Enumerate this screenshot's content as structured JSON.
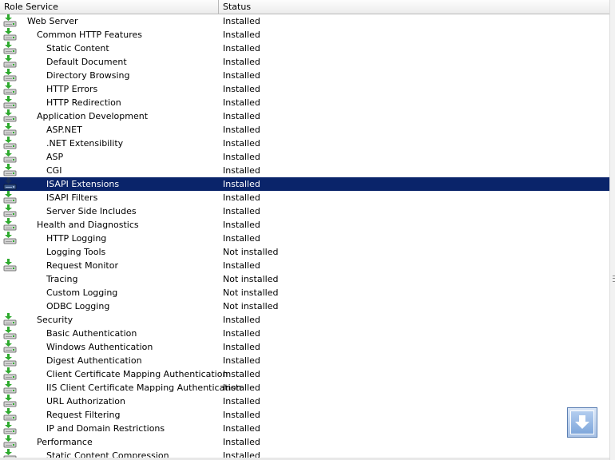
{
  "header": {
    "role_service": "Role Service",
    "status": "Status"
  },
  "rows": [
    {
      "name": "Web Server",
      "status": "Installed",
      "level": 0,
      "icon": "installed-icon"
    },
    {
      "name": "Common HTTP Features",
      "status": "Installed",
      "level": 1,
      "icon": "installed-icon"
    },
    {
      "name": "Static Content",
      "status": "Installed",
      "level": 2,
      "icon": "installed-icon"
    },
    {
      "name": "Default Document",
      "status": "Installed",
      "level": 2,
      "icon": "installed-icon"
    },
    {
      "name": "Directory Browsing",
      "status": "Installed",
      "level": 2,
      "icon": "installed-icon"
    },
    {
      "name": "HTTP Errors",
      "status": "Installed",
      "level": 2,
      "icon": "installed-icon"
    },
    {
      "name": "HTTP Redirection",
      "status": "Installed",
      "level": 2,
      "icon": "installed-icon"
    },
    {
      "name": "Application Development",
      "status": "Installed",
      "level": 1,
      "icon": "installed-icon"
    },
    {
      "name": "ASP.NET",
      "status": "Installed",
      "level": 2,
      "icon": "installed-icon"
    },
    {
      "name": ".NET Extensibility",
      "status": "Installed",
      "level": 2,
      "icon": "installed-icon"
    },
    {
      "name": "ASP",
      "status": "Installed",
      "level": 2,
      "icon": "installed-icon"
    },
    {
      "name": "CGI",
      "status": "Installed",
      "level": 2,
      "icon": "installed-icon"
    },
    {
      "name": "ISAPI Extensions",
      "status": "Installed",
      "level": 2,
      "icon": "installed-icon",
      "selected": true
    },
    {
      "name": "ISAPI Filters",
      "status": "Installed",
      "level": 2,
      "icon": "installed-icon"
    },
    {
      "name": "Server Side Includes",
      "status": "Installed",
      "level": 2,
      "icon": "installed-icon"
    },
    {
      "name": "Health and Diagnostics",
      "status": "Installed",
      "level": 1,
      "icon": "installed-icon"
    },
    {
      "name": "HTTP Logging",
      "status": "Installed",
      "level": 2,
      "icon": "installed-icon"
    },
    {
      "name": "Logging Tools",
      "status": "Not installed",
      "level": 2,
      "icon": ""
    },
    {
      "name": "Request Monitor",
      "status": "Installed",
      "level": 2,
      "icon": "installed-icon"
    },
    {
      "name": "Tracing",
      "status": "Not installed",
      "level": 2,
      "icon": ""
    },
    {
      "name": "Custom Logging",
      "status": "Not installed",
      "level": 2,
      "icon": ""
    },
    {
      "name": "ODBC Logging",
      "status": "Not installed",
      "level": 2,
      "icon": ""
    },
    {
      "name": "Security",
      "status": "Installed",
      "level": 1,
      "icon": "installed-icon"
    },
    {
      "name": "Basic Authentication",
      "status": "Installed",
      "level": 2,
      "icon": "installed-icon"
    },
    {
      "name": "Windows Authentication",
      "status": "Installed",
      "level": 2,
      "icon": "installed-icon"
    },
    {
      "name": "Digest Authentication",
      "status": "Installed",
      "level": 2,
      "icon": "installed-icon"
    },
    {
      "name": "Client Certificate Mapping Authentication",
      "status": "Installed",
      "level": 2,
      "icon": "installed-icon"
    },
    {
      "name": "IIS Client Certificate Mapping Authentication",
      "status": "Installed",
      "level": 2,
      "icon": "installed-icon"
    },
    {
      "name": "URL Authorization",
      "status": "Installed",
      "level": 2,
      "icon": "installed-icon"
    },
    {
      "name": "Request Filtering",
      "status": "Installed",
      "level": 2,
      "icon": "installed-icon"
    },
    {
      "name": "IP and Domain Restrictions",
      "status": "Installed",
      "level": 2,
      "icon": "installed-icon"
    },
    {
      "name": "Performance",
      "status": "Installed",
      "level": 1,
      "icon": "installed-icon"
    },
    {
      "name": "Static Content Compression",
      "status": "Installed",
      "level": 2,
      "icon": "installed-icon"
    }
  ],
  "colors": {
    "selection": "#0a246a",
    "selection_text": "#ffffff",
    "arrow_green": "#2eaa2e"
  },
  "floating_button_icon": "arrow-down-icon"
}
